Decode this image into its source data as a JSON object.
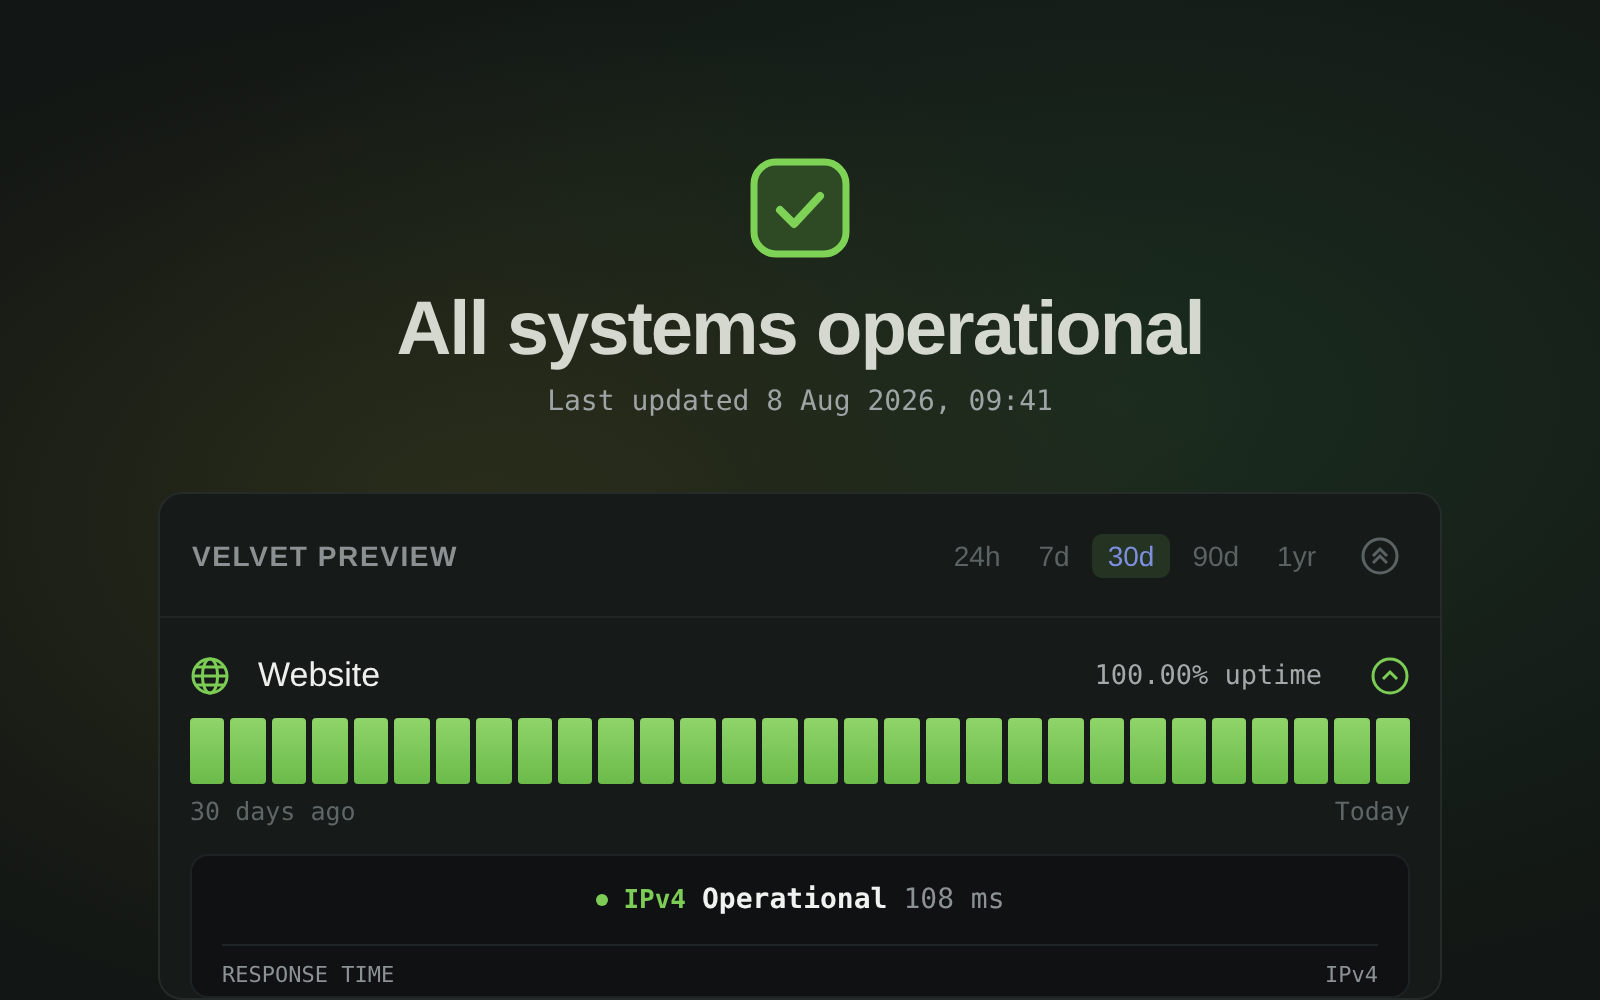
{
  "hero": {
    "title": "All systems operational",
    "updated": "Last updated 8 Aug 2026, 09:41"
  },
  "panel": {
    "title": "VELVET PREVIEW",
    "ranges": [
      {
        "label": "24h",
        "selected": false
      },
      {
        "label": "7d",
        "selected": false
      },
      {
        "label": "30d",
        "selected": true
      },
      {
        "label": "90d",
        "selected": false
      },
      {
        "label": "1yr",
        "selected": false
      }
    ],
    "expanded": true
  },
  "service": {
    "name": "Website",
    "uptime": "100.00% uptime",
    "expanded": true,
    "days": [
      {
        "kind": "up"
      },
      {
        "kind": "up"
      },
      {
        "kind": "up"
      },
      {
        "kind": "up"
      },
      {
        "kind": "up"
      },
      {
        "kind": "up"
      },
      {
        "kind": "up"
      },
      {
        "kind": "up"
      },
      {
        "kind": "up"
      },
      {
        "kind": "up"
      },
      {
        "kind": "up"
      },
      {
        "kind": "up"
      },
      {
        "kind": "up"
      },
      {
        "kind": "up"
      },
      {
        "kind": "up"
      },
      {
        "kind": "up"
      },
      {
        "kind": "up"
      },
      {
        "kind": "up"
      },
      {
        "kind": "up"
      },
      {
        "kind": "up"
      },
      {
        "kind": "up"
      },
      {
        "kind": "up"
      },
      {
        "kind": "up"
      },
      {
        "kind": "up"
      },
      {
        "kind": "up"
      },
      {
        "kind": "up"
      },
      {
        "kind": "up"
      },
      {
        "kind": "up"
      },
      {
        "kind": "up"
      },
      {
        "kind": "up"
      }
    ],
    "start_label": "30 days ago",
    "end_label": "Today",
    "detail": {
      "protocol": "IPv4",
      "color": "#7ccc55",
      "state": "Operational",
      "latency": "108 ms",
      "section": "RESPONSE TIME",
      "legend": "IPv4"
    }
  }
}
